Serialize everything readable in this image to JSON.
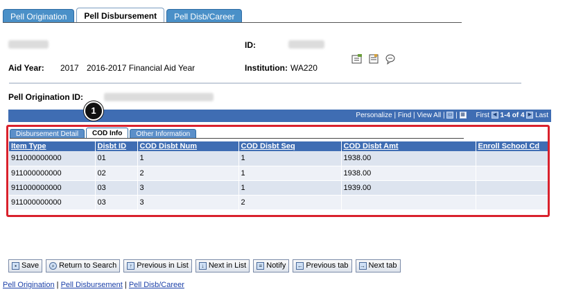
{
  "top_tabs": [
    {
      "label": "Pell Origination",
      "active": false
    },
    {
      "label": "Pell Disbursement",
      "active": true
    },
    {
      "label": "Pell Disb/Career",
      "active": false
    }
  ],
  "header": {
    "aid_year_label": "Aid Year:",
    "aid_year_value": "2017",
    "aid_year_desc": "2016-2017 Financial Aid Year",
    "id_label": "ID:",
    "institution_label": "Institution:",
    "institution_value": "WA220",
    "pell_orig_label": "Pell Origination ID:"
  },
  "grid_bar": {
    "personalize": "Personalize",
    "find": "Find",
    "view_all": "View All",
    "first": "First",
    "range": "1-4 of 4",
    "last": "Last"
  },
  "marker": "1",
  "inner_tabs": [
    {
      "label": "Disbursement Detail",
      "active": false
    },
    {
      "label": "COD Info",
      "active": true
    },
    {
      "label": "Other Information",
      "active": false
    }
  ],
  "table": {
    "headers": [
      "Item Type",
      "Disbt ID",
      "COD Disbt Num",
      "COD Disbt Seq",
      "COD Disbt Amt",
      "Enroll School Cd"
    ],
    "rows": [
      [
        "911000000000",
        "01",
        "1",
        "1",
        "1938.00",
        ""
      ],
      [
        "911000000000",
        "02",
        "2",
        "1",
        "1938.00",
        ""
      ],
      [
        "911000000000",
        "03",
        "3",
        "1",
        "1939.00",
        ""
      ],
      [
        "911000000000",
        "03",
        "3",
        "2",
        "",
        ""
      ]
    ]
  },
  "buttons": {
    "save": "Save",
    "return_search": "Return to Search",
    "prev_list": "Previous in List",
    "next_list": "Next in List",
    "notify": "Notify",
    "prev_tab": "Previous tab",
    "next_tab": "Next tab"
  },
  "footer_links": [
    "Pell Origination",
    "Pell Disbursement",
    "Pell Disb/Career"
  ],
  "colors": {
    "accent": "#3f6db3",
    "highlight": "#d9212c"
  }
}
